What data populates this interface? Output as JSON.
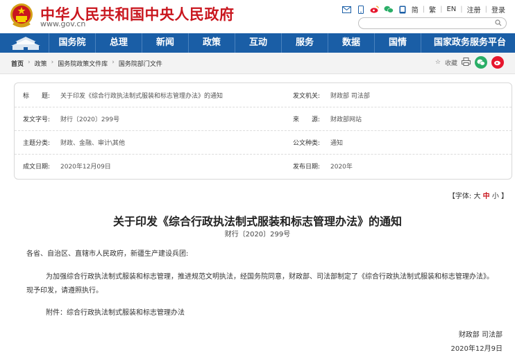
{
  "header": {
    "site_title": "中华人民共和国中央人民政府",
    "site_url": "www.gov.cn",
    "tools": [
      "简",
      "繁",
      "EN",
      "注册",
      "登录"
    ],
    "search_placeholder": ""
  },
  "nav": {
    "items": [
      "国务院",
      "总理",
      "新闻",
      "政策",
      "互动",
      "服务",
      "数据",
      "国情",
      "国家政务服务平台"
    ]
  },
  "breadcrumb": {
    "items": [
      "首页",
      "政策",
      "国务院政策文件库",
      "国务院部门文件"
    ],
    "favorite_label": "收藏"
  },
  "info": {
    "rows": [
      {
        "k1": "标　　题:",
        "v1": "关于印发《综合行政执法制式服装和标志管理办法》的通知",
        "k2": "发文机关:",
        "v2": "财政部 司法部"
      },
      {
        "k1": "发文字号:",
        "v1": "财行〔2020〕299号",
        "k2": "来　　源:",
        "v2": "财政部网站"
      },
      {
        "k1": "主题分类:",
        "v1": "财政、金融、审计\\其他",
        "k2": "公文种类:",
        "v2": "通知"
      },
      {
        "k1": "成文日期:",
        "v1": "2020年12月09日",
        "k2": "发布日期:",
        "v2": "2020年"
      }
    ]
  },
  "fontsize": {
    "prefix": "【字体:",
    "large": "大",
    "medium": "中",
    "small": "小",
    "suffix": "】"
  },
  "document": {
    "title": "关于印发《综合行政执法制式服装和标志管理办法》的通知",
    "doc_number": "财行〔2020〕299号",
    "addressee": "各省、自治区、直辖市人民政府，新疆生产建设兵团:",
    "body": "为加强综合行政执法制式服装和标志管理，推进规范文明执法，经国务院同意，财政部、司法部制定了《综合行政执法制式服装和标志管理办法》。现予印发，请遵照执行。",
    "attachment": "附件：综合行政执法制式服装和标志管理办法",
    "signature": "财政部 司法部",
    "date": "2020年12月9日"
  },
  "colors": {
    "brand_red": "#c9161e",
    "nav_blue": "#1a5ea6"
  }
}
